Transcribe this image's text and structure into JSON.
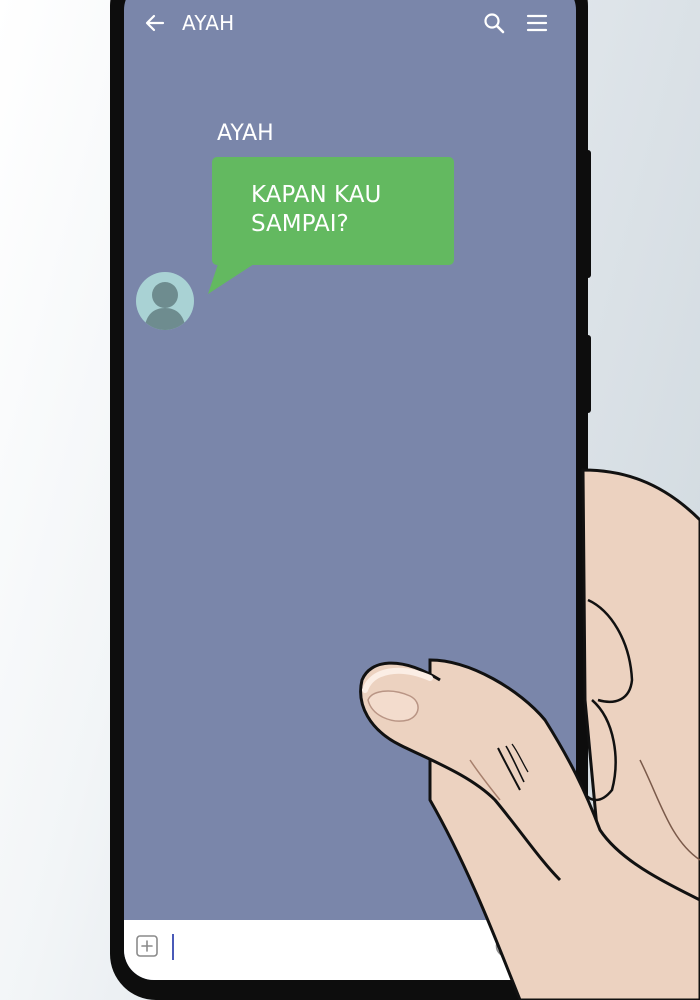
{
  "header": {
    "back_icon": "arrow-left-icon",
    "title": "AYAH",
    "search_icon": "search-icon",
    "menu_icon": "hamburger-menu-icon"
  },
  "messages": [
    {
      "sender": "AYAH",
      "text_lines": [
        "KAPAN KAU",
        "SAMPAI?"
      ],
      "bubble_color": "#63b960",
      "avatar_icon": "default-avatar-icon"
    }
  ],
  "composer": {
    "add_icon": "plus-square-icon",
    "input_value": "",
    "emoji_icon": "smiley-icon"
  },
  "colors": {
    "chat_background": "#7a86aa",
    "bubble": "#63b960",
    "text": "#ffffff",
    "skin": "#ecd2c0"
  }
}
